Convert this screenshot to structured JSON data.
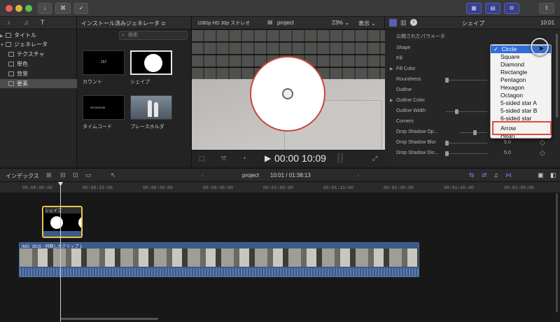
{
  "toolbar": {
    "keyword_btn": "⌘",
    "import_icon": "down-arrow-icon",
    "check_icon": "check-circle-icon"
  },
  "library": {
    "items": [
      {
        "label": "タイトル",
        "expanded": false
      },
      {
        "label": "ジェネレータ",
        "expanded": true
      },
      {
        "label": "テクスチャ"
      },
      {
        "label": "単色"
      },
      {
        "label": "背景"
      },
      {
        "label": "要素",
        "selected": true
      }
    ]
  },
  "generators": {
    "header": "インストール済みジェネレータ ≎",
    "search_placeholder": "検索",
    "thumbs": [
      {
        "label": "カウント",
        "overlay": "157"
      },
      {
        "label": "シェイプ",
        "selected": true
      },
      {
        "label": "タイムコード",
        "overlay": "00:00:00:00"
      },
      {
        "label": "プレースホルダ"
      }
    ]
  },
  "viewer": {
    "format": "1080p HD 30p ステレオ",
    "project": "project",
    "zoom": "23% ⌄",
    "view": "表示 ⌄",
    "timecode": "00:00 10:09"
  },
  "inspector": {
    "title": "シェイプ",
    "timecode": "10:01",
    "section": "公開されたパラメータ",
    "params": [
      {
        "label": "Shape",
        "value": ""
      },
      {
        "label": "Fill",
        "value": ""
      },
      {
        "label": "Fill Color",
        "value": "",
        "disclosure": true
      },
      {
        "label": "Roundness",
        "value": ""
      },
      {
        "label": "Outline",
        "value": ""
      },
      {
        "label": "Outline Color",
        "value": "",
        "disclosure": true
      },
      {
        "label": "Outline Width",
        "value": ""
      },
      {
        "label": "Corners",
        "value": ""
      },
      {
        "label": "Drop Shadow Op...",
        "value": ""
      },
      {
        "label": "Drop Shadow Blur",
        "value": "5.0"
      },
      {
        "label": "Drop Shadow Dis...",
        "value": "5.0"
      }
    ]
  },
  "shape_menu": {
    "options": [
      "Circle",
      "Square",
      "Diamond",
      "Rectangle",
      "Pentagon",
      "Hexagon",
      "Octagon",
      "5-sided star A",
      "5-sided star B",
      "6-sided star",
      "Arrow",
      "Heart"
    ],
    "selected": "Circle",
    "highlighted": "Arrow",
    "check_mark": "✓"
  },
  "timeline": {
    "index_label": "インデックス",
    "project": "project",
    "duration": "10:01 / 01:38:13",
    "ruler": [
      "00:00:00:00",
      "00:00:15:00",
      "00:00:30:00",
      "00:00:45:00",
      "00:01:00:00",
      "00:01:15:00",
      "00:01:30:00",
      "00:01:45:00",
      "00:02:00:00"
    ],
    "clip_shape_label": "シェイプ",
    "clip_video_label": "IMG_3915 - 同期したクリップ 1"
  },
  "colors": {
    "accent_blue": "#2f6ed8",
    "highlight_red": "#e04a3b",
    "clip_yellow": "#e8c54a",
    "clip_video_blue": "#3a5a8a"
  }
}
